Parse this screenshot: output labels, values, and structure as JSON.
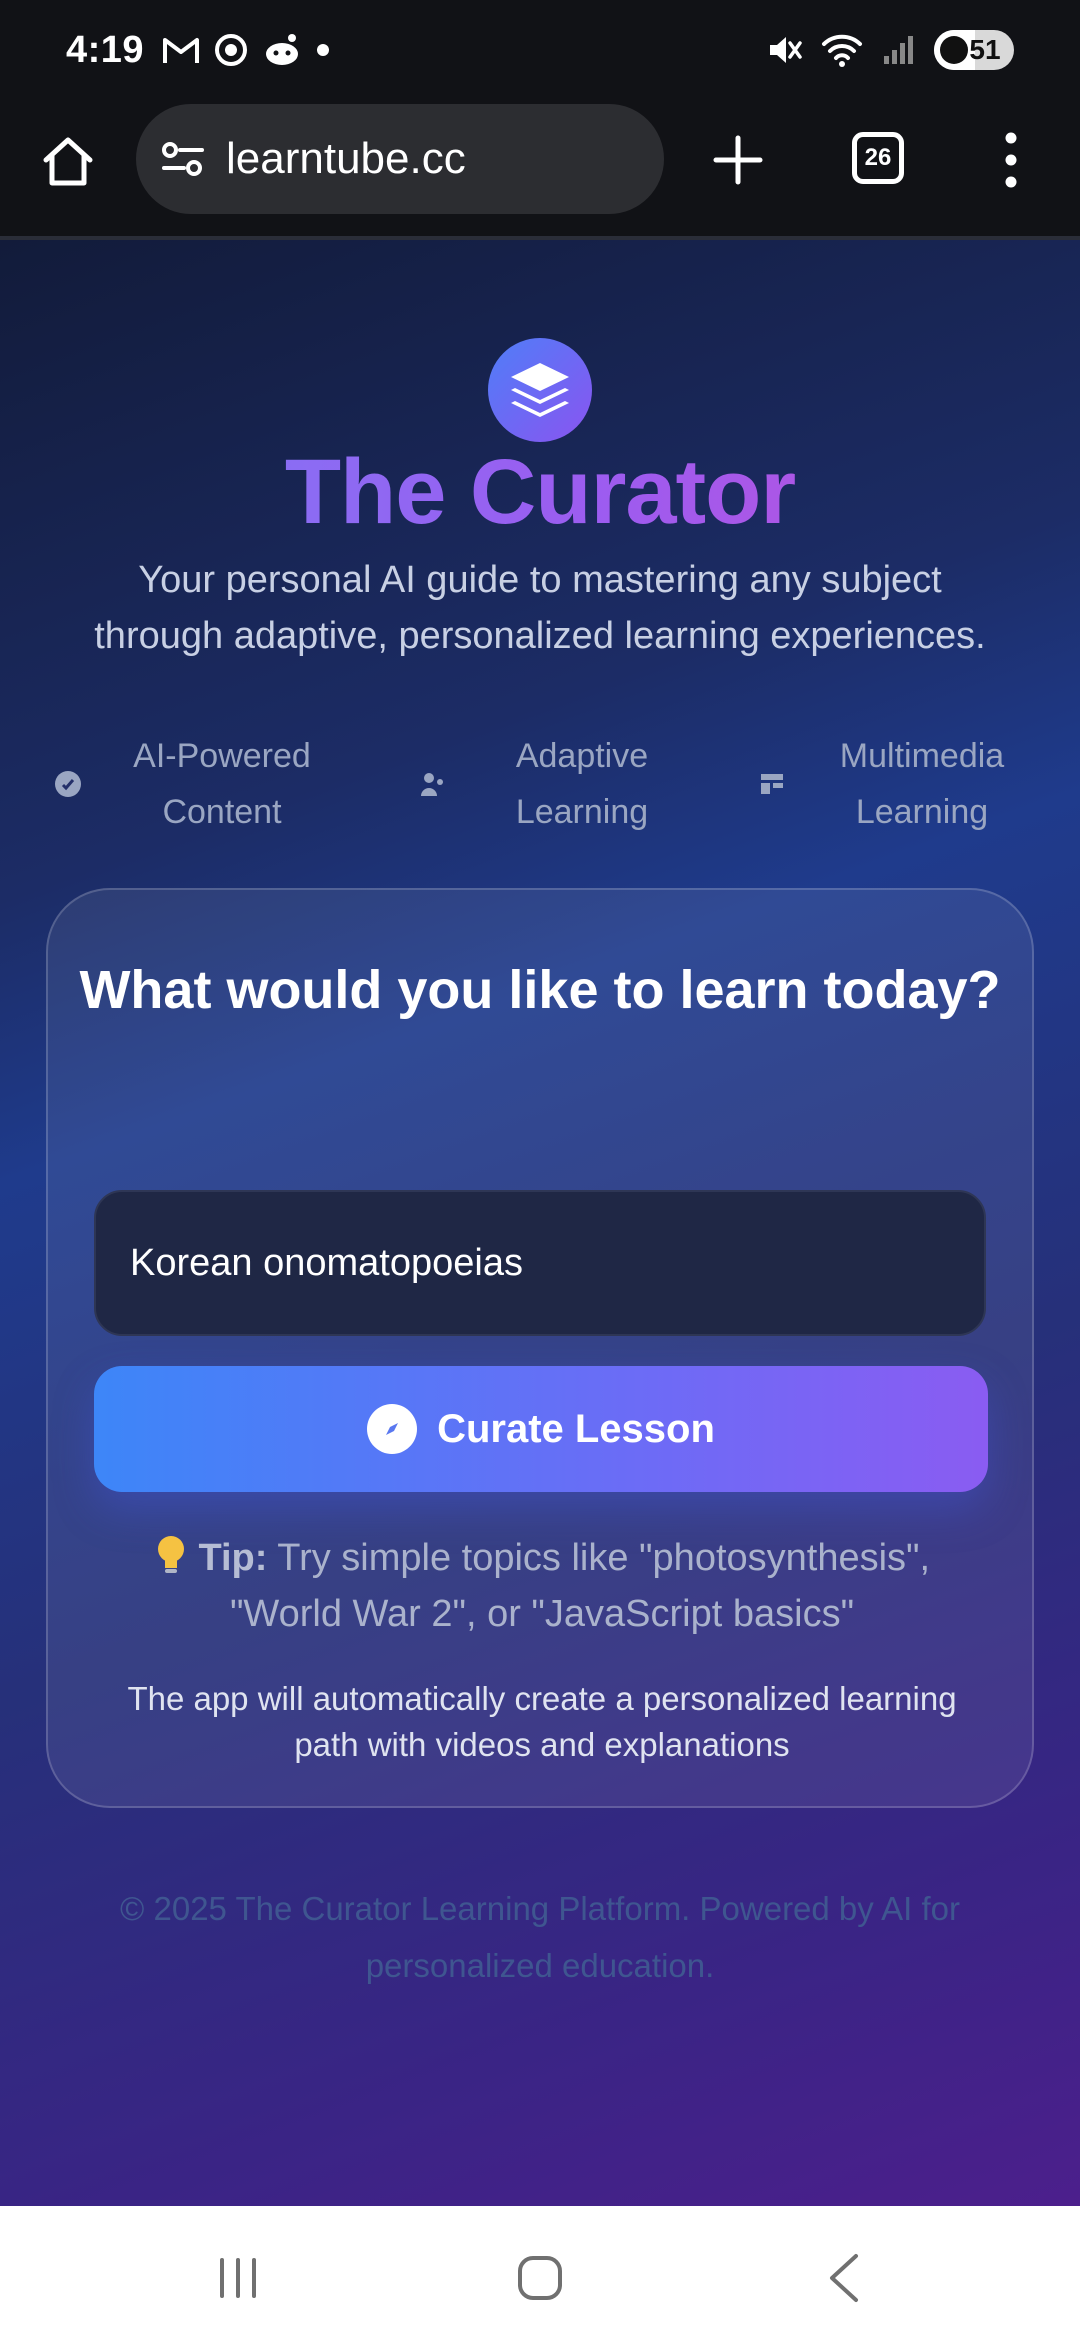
{
  "status_bar": {
    "time": "4:19",
    "battery_level": "51",
    "left_icons": [
      "gmail-icon",
      "chrome-icon",
      "reddit-icon",
      "dot-icon"
    ],
    "right_icons": [
      "mute-icon",
      "wifi-icon",
      "signal-icon",
      "battery-icon"
    ]
  },
  "browser": {
    "url": "learntube.cc",
    "tab_count": "26"
  },
  "page": {
    "title": "The Curator",
    "subtitle": "Your personal AI guide to mastering any subject through adaptive, personalized learning experiences.",
    "features": [
      {
        "line1": "AI-Powered",
        "line2": "Content"
      },
      {
        "line1": "Adaptive",
        "line2": "Learning"
      },
      {
        "line1": "Multimedia",
        "line2": "Learning"
      }
    ],
    "card": {
      "heading": "What would you like to learn today?",
      "input_value": "Korean onomatopoeias",
      "button_label": "Curate Lesson",
      "tip_label": "Tip:",
      "tip_text": " Try simple topics like \"photosynthesis\", \"World War 2\", or \"JavaScript basics\"",
      "info_text": "The app will automatically create a personalized learning path with videos and explanations"
    },
    "footer": "© 2025 The Curator Learning Platform. Powered by AI for personalized education."
  },
  "colors": {
    "title_gradient": [
      "#7a7cf6",
      "#9c5cf0",
      "#c24fd8"
    ],
    "button_gradient": [
      "#3d86f8",
      "#8a5cf2"
    ],
    "input_bg": "#1f2745"
  }
}
